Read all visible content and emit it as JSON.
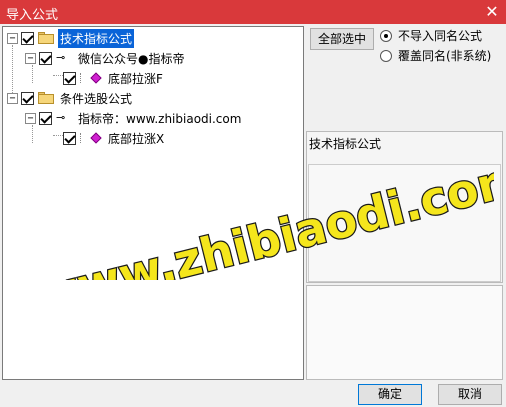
{
  "window": {
    "title": "导入公式",
    "close_icon": "close-icon"
  },
  "tree": {
    "groups": [
      {
        "label": "技术指标公式",
        "selected": true,
        "checked": true,
        "children": [
          {
            "label": "微信公众号●指标帝",
            "checked": true,
            "leaves": [
              {
                "label": "底部拉涨F",
                "checked": true
              }
            ]
          }
        ]
      },
      {
        "label": "条件选股公式",
        "selected": false,
        "checked": true,
        "children": [
          {
            "label": "指标帝：www.zhibiaodi.com",
            "checked": true,
            "leaves": [
              {
                "label": "底部拉涨X",
                "checked": true
              }
            ]
          }
        ]
      }
    ]
  },
  "options": {
    "select_all_label": "全部选中",
    "radio_no_import": "不导入同名公式",
    "radio_overwrite": "覆盖同名(非系统)",
    "selected_radio": "no_import"
  },
  "info": {
    "header": "技术指标公式"
  },
  "buttons": {
    "ok": "确定",
    "cancel": "取消"
  },
  "watermark": {
    "text": "www.zhibiaodi.com"
  },
  "colors": {
    "title_bar": "#d9393b",
    "selection": "#0a64d8",
    "watermark_fill": "#f5e61c",
    "watermark_stroke": "#1a1a1a"
  }
}
